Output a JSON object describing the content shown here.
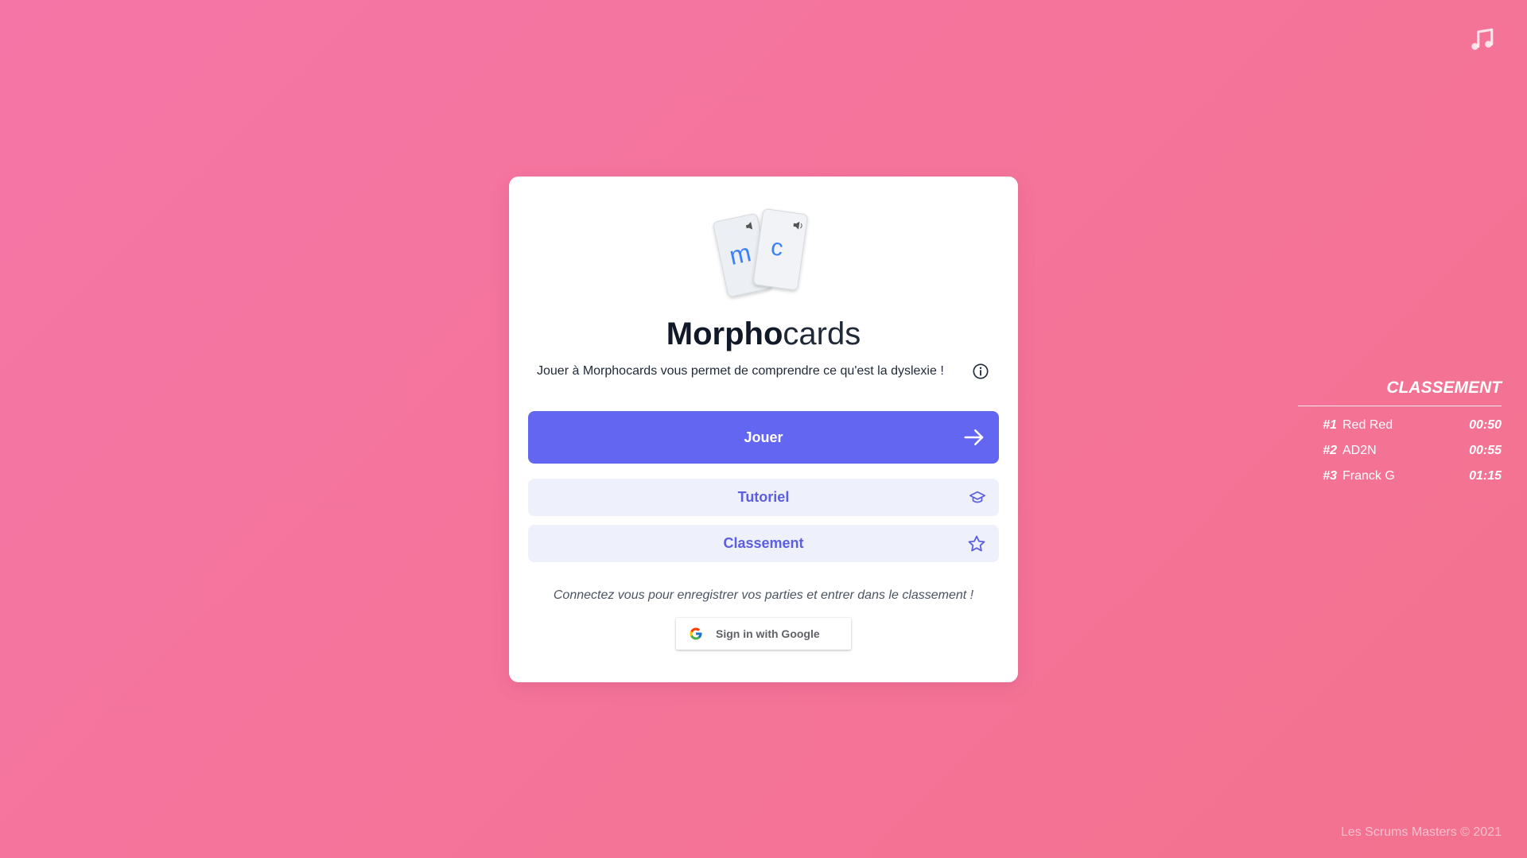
{
  "colors": {
    "background": "#f4749c",
    "card": "#ffffff",
    "primary": "#6366f1",
    "secondary_bg": "#eef0fc",
    "secondary_text": "#5b5ee0"
  },
  "header": {
    "music_icon": "music-note-icon"
  },
  "card": {
    "logo": {
      "card_letters": [
        "m",
        "c"
      ],
      "icon": "speaker-icon"
    },
    "title_bold": "Morpho",
    "title_light": "cards",
    "subtitle": "Jouer à Morphocards vous permet de comprendre ce qu'est la dyslexie !",
    "info_icon": "info-icon",
    "buttons": {
      "play": {
        "label": "Jouer",
        "icon": "arrow-right-icon"
      },
      "tutorial": {
        "label": "Tutoriel",
        "icon": "graduation-cap-icon"
      },
      "ranking": {
        "label": "Classement",
        "icon": "star-icon"
      }
    },
    "connect_text": "Connectez vous pour enregistrer vos parties et entrer dans le classement !",
    "google": {
      "label": "Sign in with Google",
      "icon": "google-icon"
    }
  },
  "ranking": {
    "title": "CLASSEMENT",
    "rows": [
      {
        "rank": "#1",
        "name": "Red Red",
        "time": "00:50"
      },
      {
        "rank": "#2",
        "name": "AD2N",
        "time": "00:55"
      },
      {
        "rank": "#3",
        "name": "Franck G",
        "time": "01:15"
      }
    ]
  },
  "footer": {
    "text": "Les Scrums Masters © 2021"
  }
}
